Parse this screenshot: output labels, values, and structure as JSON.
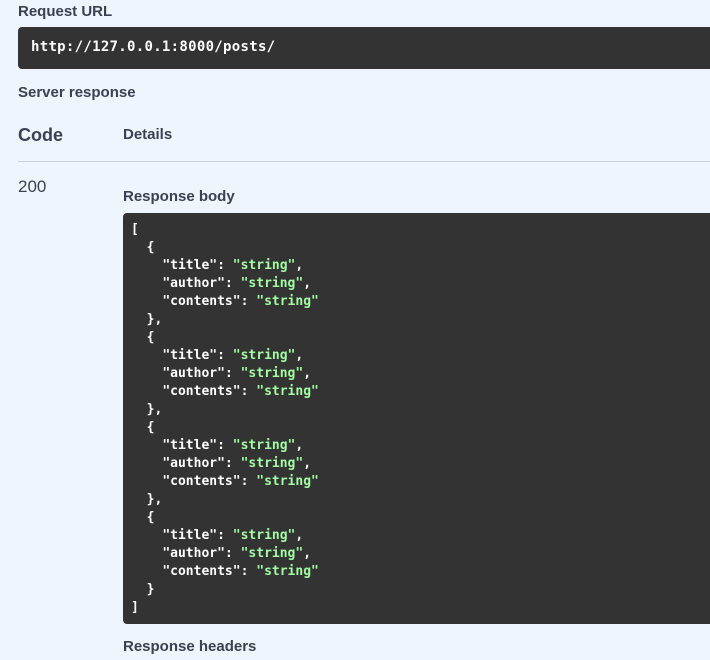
{
  "request_url": {
    "label": "Request URL",
    "value": "http://127.0.0.1:8000/posts/"
  },
  "server_response": {
    "label": "Server response",
    "columns": {
      "code": "Code",
      "details": "Details"
    },
    "row": {
      "code": "200",
      "body_label": "Response body",
      "body": [
        {
          "title": "string",
          "author": "string",
          "contents": "string"
        },
        {
          "title": "string",
          "author": "string",
          "contents": "string"
        },
        {
          "title": "string",
          "author": "string",
          "contents": "string"
        },
        {
          "title": "string",
          "author": "string",
          "contents": "string"
        }
      ],
      "headers_label": "Response headers"
    }
  },
  "colors": {
    "page_background": "#eef5fd",
    "code_background": "#333333",
    "json_string": "#a2fca2",
    "text": "#3b4151"
  }
}
